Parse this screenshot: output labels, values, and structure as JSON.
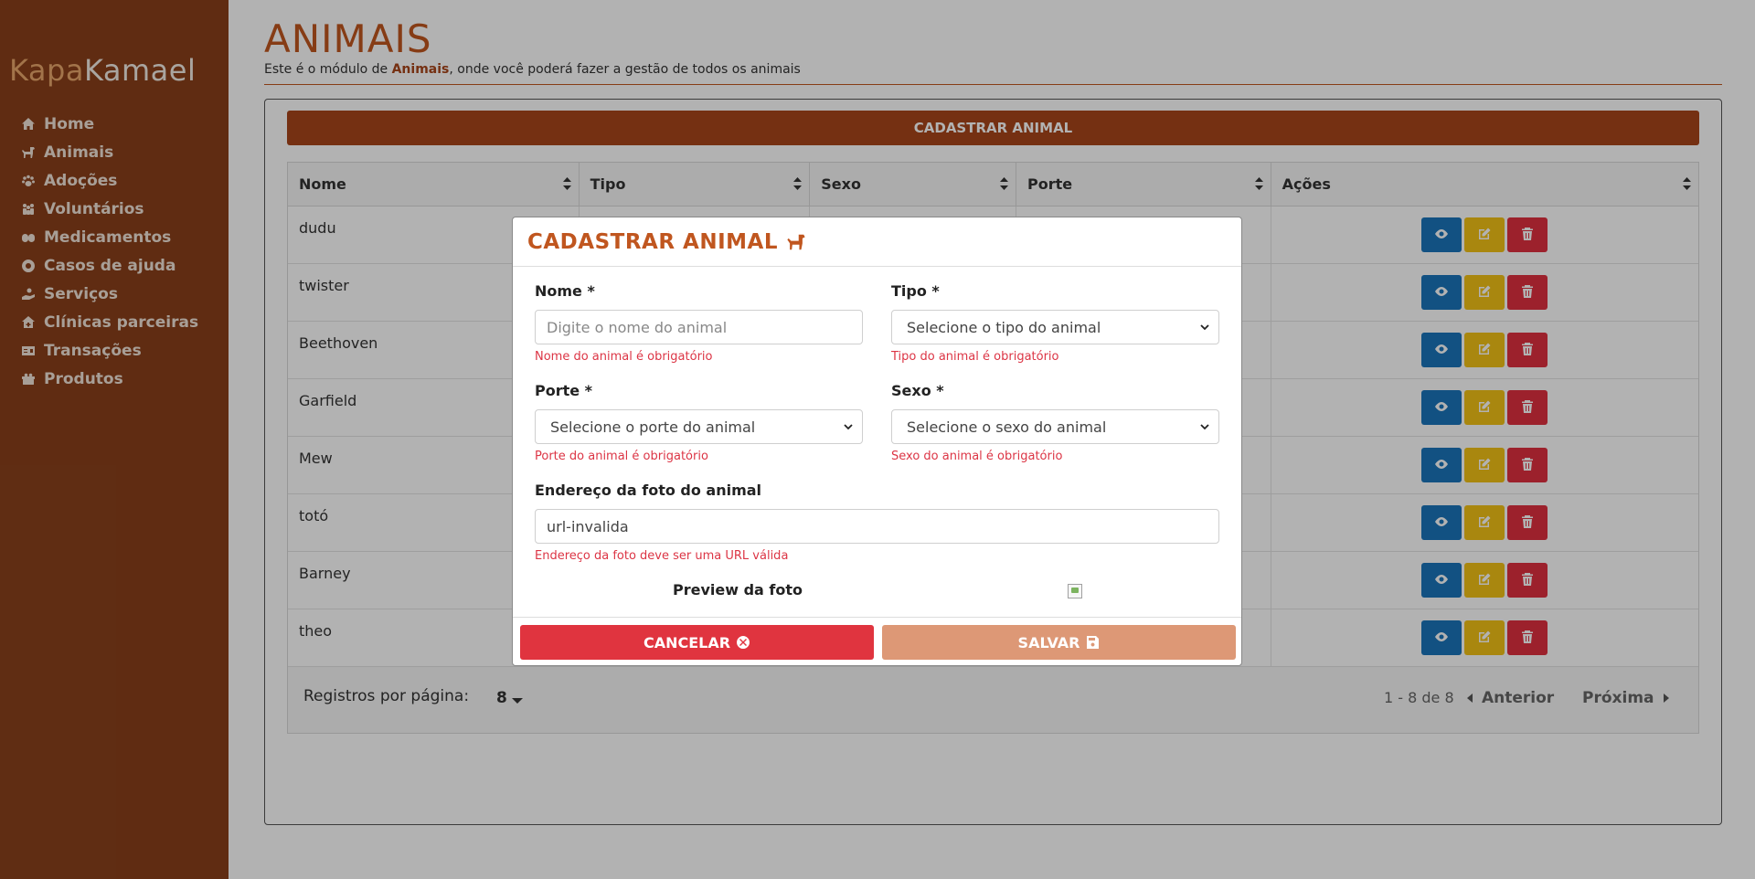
{
  "app": {
    "logo_part1": "Kapa",
    "logo_part2": "Kamael"
  },
  "colors": {
    "sidebar": "#8a401b",
    "accent": "#c0561f",
    "primary_button": "#a8451a",
    "view": "#1b75bb",
    "edit": "#f2c216",
    "delete": "#e0303f"
  },
  "nav": [
    {
      "label": "Home",
      "icon": "home-icon"
    },
    {
      "label": "Animais",
      "icon": "dog-icon"
    },
    {
      "label": "Adoções",
      "icon": "paw-icon"
    },
    {
      "label": "Voluntários",
      "icon": "people-icon"
    },
    {
      "label": "Medicamentos",
      "icon": "pills-icon"
    },
    {
      "label": "Casos de ajuda",
      "icon": "lifebuoy-icon"
    },
    {
      "label": "Serviços",
      "icon": "hand-holding-icon"
    },
    {
      "label": "Clínicas parceiras",
      "icon": "clinic-icon"
    },
    {
      "label": "Transações",
      "icon": "money-icon"
    },
    {
      "label": "Produtos",
      "icon": "gift-box-icon"
    }
  ],
  "page": {
    "title": "ANIMAIS",
    "subtitle_before": "Este é o módulo de ",
    "subtitle_bold": "Animais",
    "subtitle_after": ", onde você poderá fazer a gestão de todos os animais",
    "register_button": "CADASTRAR ANIMAL"
  },
  "table": {
    "columns": [
      "Nome",
      "Tipo",
      "Sexo",
      "Porte",
      "Ações"
    ],
    "rows": [
      {
        "nome": "dudu"
      },
      {
        "nome": "twister"
      },
      {
        "nome": "Beethoven"
      },
      {
        "nome": "Garfield"
      },
      {
        "nome": "Mew"
      },
      {
        "nome": "totó"
      },
      {
        "nome": "Barney"
      },
      {
        "nome": "theo"
      }
    ],
    "per_page_label": "Registros por página:",
    "per_page_value": "8",
    "range": "1 - 8 de 8",
    "prev": "Anterior",
    "next": "Próxima"
  },
  "modal": {
    "title": "CADASTRAR ANIMAL",
    "nome": {
      "label": "Nome *",
      "placeholder": "Digite o nome do animal",
      "error": "Nome do animal é obrigatório"
    },
    "tipo": {
      "label": "Tipo *",
      "placeholder": "Selecione o tipo do animal",
      "error": "Tipo do animal é obrigatório"
    },
    "porte": {
      "label": "Porte *",
      "placeholder": "Selecione o porte do animal",
      "error": "Porte do animal é obrigatório"
    },
    "sexo": {
      "label": "Sexo *",
      "placeholder": "Selecione o sexo do animal",
      "error": "Sexo do animal é obrigatório"
    },
    "foto": {
      "label": "Endereço da foto do animal",
      "value": "url-invalida",
      "error": "Endereço da foto deve ser uma URL válida"
    },
    "preview_label": "Preview da foto",
    "cancel": "CANCELAR",
    "save": "SALVAR"
  }
}
